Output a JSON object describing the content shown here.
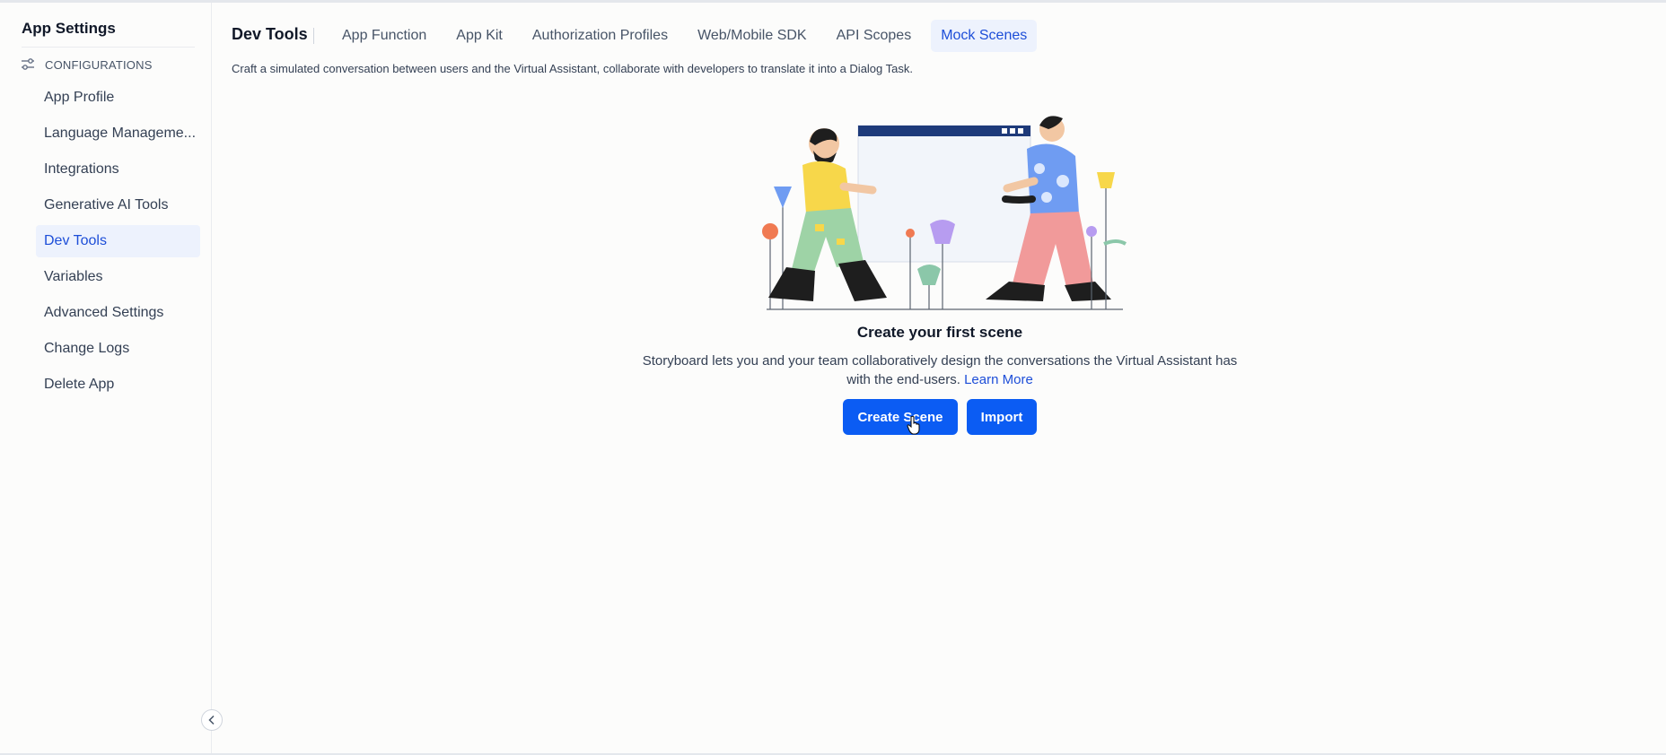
{
  "sidebar": {
    "title": "App Settings",
    "section_label": "CONFIGURATIONS",
    "section_icon": "sliders-icon",
    "items": [
      {
        "label": "App Profile"
      },
      {
        "label": "Language Manageme..."
      },
      {
        "label": "Integrations"
      },
      {
        "label": "Generative AI Tools"
      },
      {
        "label": "Dev Tools",
        "active": true
      },
      {
        "label": "Variables"
      },
      {
        "label": "Advanced Settings"
      },
      {
        "label": "Change Logs"
      },
      {
        "label": "Delete App"
      }
    ],
    "collapse_icon": "chevron-left-icon"
  },
  "header": {
    "title": "Dev Tools",
    "tabs": [
      {
        "label": "App Function"
      },
      {
        "label": "App Kit"
      },
      {
        "label": "Authorization Profiles"
      },
      {
        "label": "Web/Mobile SDK"
      },
      {
        "label": "API Scopes"
      },
      {
        "label": "Mock Scenes",
        "active": true
      }
    ],
    "description": "Craft a simulated conversation between users and the Virtual Assistant, collaborate with developers to translate it into a Dialog Task."
  },
  "empty_state": {
    "illustration": "collaboration-illustration",
    "title": "Create your first scene",
    "description": "Storyboard lets you and your team collaboratively design the conversations the Virtual Assistant has with the end-users.",
    "learn_more": "Learn More",
    "create_label": "Create Scene",
    "import_label": "Import"
  },
  "colors": {
    "accent": "#0b5cf3",
    "active_bg": "#edf2fd",
    "active_text": "#1d4ed8"
  }
}
